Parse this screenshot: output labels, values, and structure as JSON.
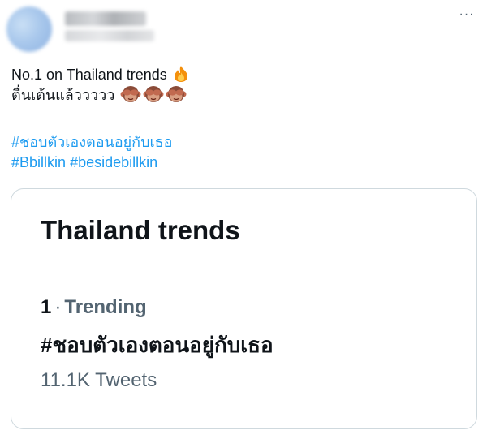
{
  "tweet": {
    "text_line1": "No.1 on Thailand trends",
    "text_line2": "ตื่นเต้นแล้ววววว",
    "hashtag_line1": "#ชอบตัวเองตอนอยู่กับเธอ",
    "hashtag_line2_a": "#Bbillkin",
    "hashtag_line2_b": "#besidebillkin",
    "more_label": "···",
    "emoji": [
      "fire-emoji",
      "see-no-evil-monkey-emoji",
      "see-no-evil-monkey-emoji",
      "see-no-evil-monkey-emoji"
    ]
  },
  "card": {
    "title": "Thailand trends",
    "rank": "1",
    "separator": "·",
    "trending_label": "Trending",
    "hashtag": "#ชอบตัวเองตอนอยู่กับเธอ",
    "tweet_count": "11.1K Tweets"
  },
  "colors": {
    "link": "#1d9bf0",
    "text": "#0f1419",
    "secondary": "#536471",
    "border": "#cfd9de"
  }
}
